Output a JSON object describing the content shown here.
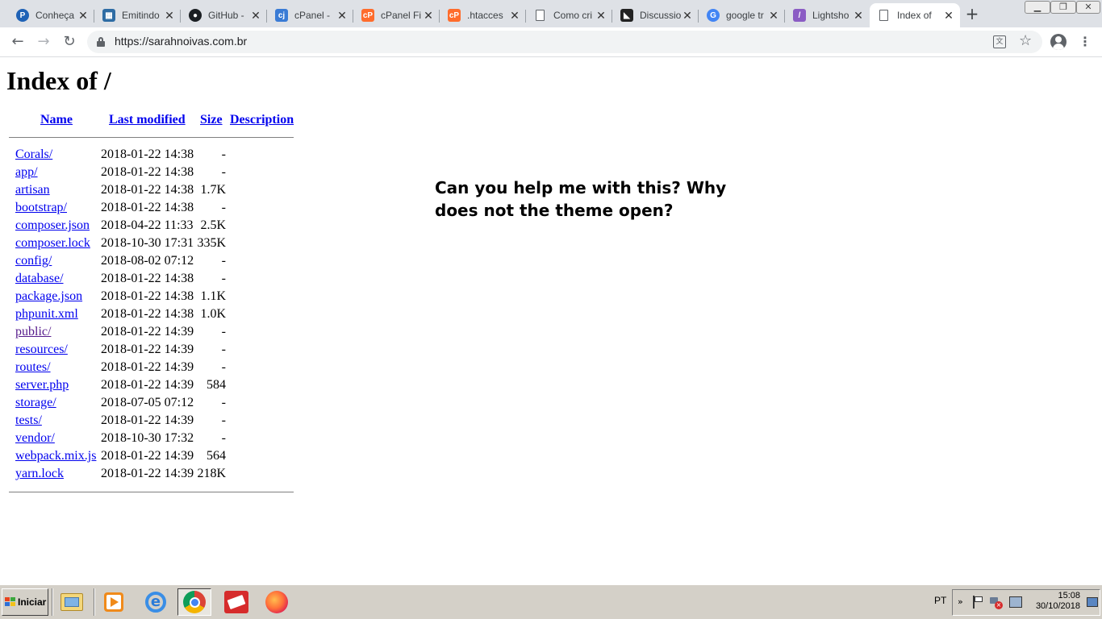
{
  "browser": {
    "tabs": [
      {
        "title": "Conheça",
        "icon": "paypal-icon",
        "color": "#1f62b6",
        "glyph": "P",
        "round": true
      },
      {
        "title": "Emitindo",
        "icon": "cube-icon",
        "color": "#2e6ca4",
        "glyph": "▦",
        "round": false
      },
      {
        "title": "GitHub -",
        "icon": "github-icon",
        "color": "#1b1f23",
        "glyph": "●",
        "round": true
      },
      {
        "title": "cPanel -",
        "icon": "cpanel-icon",
        "color": "#3a7bd5",
        "glyph": "cj",
        "round": false
      },
      {
        "title": "cPanel Fi",
        "icon": "cpanel-icon",
        "color": "#ff6c2c",
        "glyph": "cP",
        "round": false
      },
      {
        "title": ".htacces",
        "icon": "cpanel-icon",
        "color": "#ff6c2c",
        "glyph": "cP",
        "round": false
      },
      {
        "title": "Como cri",
        "icon": "page-icon",
        "color": "#ffffff",
        "glyph": "",
        "round": false
      },
      {
        "title": "Discussio",
        "icon": "forum-icon",
        "color": "#222222",
        "glyph": "◣",
        "round": false
      },
      {
        "title": "google tr",
        "icon": "google-icon",
        "color": "#4285f4",
        "glyph": "G",
        "round": true
      },
      {
        "title": "Lightsho",
        "icon": "feather-icon",
        "color": "#8b5cc4",
        "glyph": "/",
        "round": false
      },
      {
        "title": "Index of",
        "icon": "page-icon",
        "color": "#ffffff",
        "glyph": "",
        "round": false,
        "active": true
      }
    ],
    "url": "https://sarahnoivas.com.br"
  },
  "page": {
    "title": "Index of /",
    "columns": {
      "name": "Name",
      "modified": "Last modified",
      "size": "Size",
      "description": "Description"
    },
    "rows": [
      {
        "name": "Corals/",
        "modified": "2018-01-22 14:38",
        "size": "-"
      },
      {
        "name": "app/",
        "modified": "2018-01-22 14:38",
        "size": "-"
      },
      {
        "name": "artisan",
        "modified": "2018-01-22 14:38",
        "size": "1.7K"
      },
      {
        "name": "bootstrap/",
        "modified": "2018-01-22 14:38",
        "size": "-"
      },
      {
        "name": "composer.json",
        "modified": "2018-04-22 11:33",
        "size": "2.5K"
      },
      {
        "name": "composer.lock",
        "modified": "2018-10-30 17:31",
        "size": "335K"
      },
      {
        "name": "config/",
        "modified": "2018-08-02 07:12",
        "size": "-"
      },
      {
        "name": "database/",
        "modified": "2018-01-22 14:38",
        "size": "-"
      },
      {
        "name": "package.json",
        "modified": "2018-01-22 14:38",
        "size": "1.1K"
      },
      {
        "name": "phpunit.xml",
        "modified": "2018-01-22 14:38",
        "size": "1.0K"
      },
      {
        "name": "public/",
        "modified": "2018-01-22 14:39",
        "size": "-",
        "visited": true
      },
      {
        "name": "resources/",
        "modified": "2018-01-22 14:39",
        "size": "-"
      },
      {
        "name": "routes/",
        "modified": "2018-01-22 14:39",
        "size": "-"
      },
      {
        "name": "server.php",
        "modified": "2018-01-22 14:39",
        "size": "584"
      },
      {
        "name": "storage/",
        "modified": "2018-07-05 07:12",
        "size": "-"
      },
      {
        "name": "tests/",
        "modified": "2018-01-22 14:39",
        "size": "-"
      },
      {
        "name": "vendor/",
        "modified": "2018-10-30 17:32",
        "size": "-"
      },
      {
        "name": "webpack.mix.js",
        "modified": "2018-01-22 14:39",
        "size": "564"
      },
      {
        "name": "yarn.lock",
        "modified": "2018-01-22 14:39",
        "size": "218K"
      }
    ],
    "question": "Can you help me with this? Why does not the theme open?"
  },
  "taskbar": {
    "start_label": "Iniciar",
    "language": "PT",
    "time": "15:08",
    "date": "30/10/2018"
  }
}
